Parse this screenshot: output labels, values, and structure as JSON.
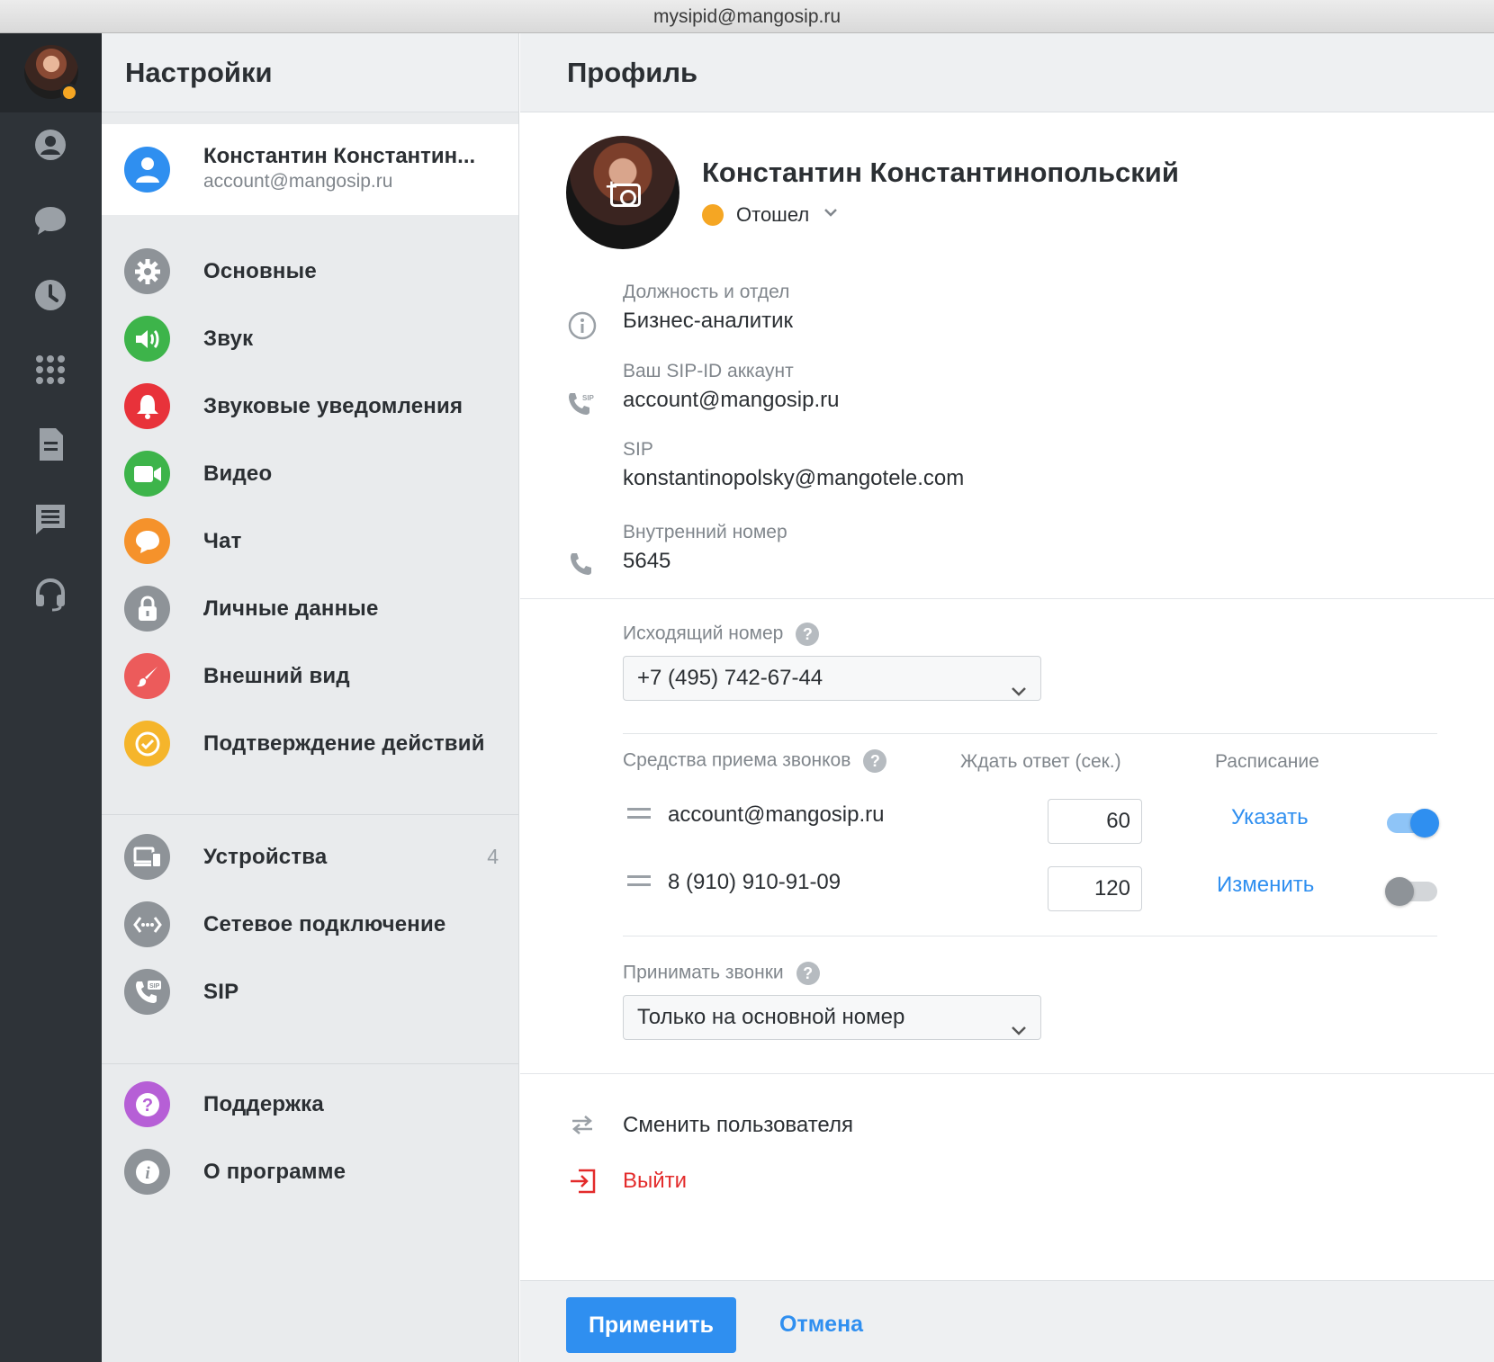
{
  "window": {
    "title": "mysipid@mangosip.ru"
  },
  "rail": {
    "icons": [
      "avatar",
      "contacts-icon",
      "chat-icon",
      "history-icon",
      "dialpad-icon",
      "document-icon",
      "list-icon",
      "headset-icon"
    ],
    "status_color": "#f5a623"
  },
  "settings": {
    "title": "Настройки",
    "account": {
      "name": "Константин Константин...",
      "email": "account@mangosip.ru"
    },
    "items": [
      {
        "label": "Основные",
        "icon": "gear-icon",
        "color": "#8e9398"
      },
      {
        "label": "Звук",
        "icon": "speaker-icon",
        "color": "#3db44a"
      },
      {
        "label": "Звуковые уведомления",
        "icon": "bell-icon",
        "color": "#e8323a"
      },
      {
        "label": "Видео",
        "icon": "video-icon",
        "color": "#3db44a"
      },
      {
        "label": "Чат",
        "icon": "chat-bubble-icon",
        "color": "#f5922b"
      },
      {
        "label": "Личные данные",
        "icon": "lock-icon",
        "color": "#8e9398"
      },
      {
        "label": "Внешний вид",
        "icon": "brush-icon",
        "color": "#ec5b5b"
      },
      {
        "label": "Подтверждение действий",
        "icon": "check-icon",
        "color": "#f5b52b"
      },
      {
        "label": "Устройства",
        "icon": "devices-icon",
        "color": "#8e9398",
        "badge": "4"
      },
      {
        "label": "Сетевое подключение",
        "icon": "network-icon",
        "color": "#8e9398"
      },
      {
        "label": "SIP",
        "icon": "sip-phone-icon",
        "color": "#8e9398"
      },
      {
        "label": "Поддержка",
        "icon": "question-icon",
        "color": "#b65fd6"
      },
      {
        "label": "О программе",
        "icon": "info-icon",
        "color": "#8e9398"
      }
    ]
  },
  "profile": {
    "title": "Профиль",
    "name": "Константин Константинопольский",
    "status": "Отошел",
    "status_color": "#f5a623",
    "fields": {
      "position": {
        "label": "Должность и отдел",
        "value": "Бизнес-аналитик"
      },
      "sip_id": {
        "label": "Ваш SIP-ID аккаунт",
        "value": "account@mangosip.ru"
      },
      "sip": {
        "label": "SIP",
        "value": "konstantinopolsky@mangotele.com"
      },
      "internal": {
        "label": "Внутренний номер",
        "value": "5645"
      }
    },
    "outgoing": {
      "label": "Исходящий номер",
      "value": "+7 (495) 742-67-44"
    },
    "receive_table": {
      "headers": [
        "Средства приема звонков",
        "Ждать ответ (сек.)",
        "Расписание"
      ],
      "rows": [
        {
          "name": "account@mangosip.ru",
          "wait": "60",
          "schedule": "Указать",
          "enabled": true
        },
        {
          "name": "8 (910) 910-91-09",
          "wait": "120",
          "schedule": "Изменить",
          "enabled": false
        }
      ]
    },
    "accept_calls": {
      "label": "Принимать звонки",
      "value": "Только на основной номер"
    },
    "actions": {
      "switch_user": "Сменить пользователя",
      "logout": "Выйти"
    },
    "footer": {
      "apply": "Применить",
      "cancel": "Отмена"
    },
    "accent_color": "#2f8ff0",
    "danger_color": "#e32b2b"
  }
}
